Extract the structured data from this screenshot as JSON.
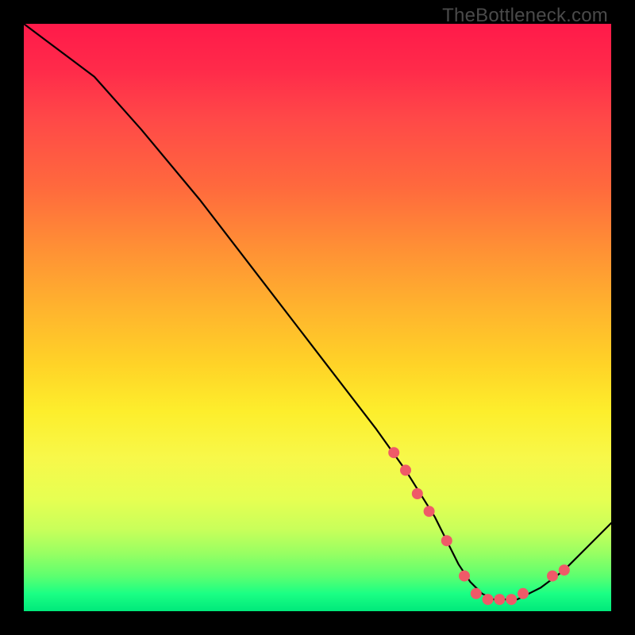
{
  "watermark": "TheBottleneck.com",
  "colors": {
    "marker": "#ef5a68",
    "line": "#000000"
  },
  "chart_data": {
    "type": "line",
    "title": "",
    "xlabel": "",
    "ylabel": "",
    "xlim": [
      0,
      100
    ],
    "ylim": [
      0,
      100
    ],
    "grid": false,
    "legend": false,
    "background": "rainbow-vertical",
    "series": [
      {
        "name": "bottleneck-curve",
        "x": [
          0,
          4,
          8,
          12,
          20,
          30,
          40,
          50,
          60,
          65,
          70,
          72,
          74,
          76,
          78,
          80,
          82,
          84,
          86,
          88,
          92,
          96,
          100
        ],
        "y": [
          100,
          97,
          94,
          91,
          82,
          70,
          57,
          44,
          31,
          24,
          16,
          12,
          8,
          5,
          3,
          2,
          2,
          2,
          3,
          4,
          7,
          11,
          15
        ]
      }
    ],
    "markers": [
      {
        "x": 63,
        "y": 27
      },
      {
        "x": 65,
        "y": 24
      },
      {
        "x": 67,
        "y": 20
      },
      {
        "x": 69,
        "y": 17
      },
      {
        "x": 72,
        "y": 12
      },
      {
        "x": 75,
        "y": 6
      },
      {
        "x": 77,
        "y": 3
      },
      {
        "x": 79,
        "y": 2
      },
      {
        "x": 81,
        "y": 2
      },
      {
        "x": 83,
        "y": 2
      },
      {
        "x": 85,
        "y": 3
      },
      {
        "x": 90,
        "y": 6
      },
      {
        "x": 92,
        "y": 7
      }
    ],
    "marker_radius_px": 7
  }
}
